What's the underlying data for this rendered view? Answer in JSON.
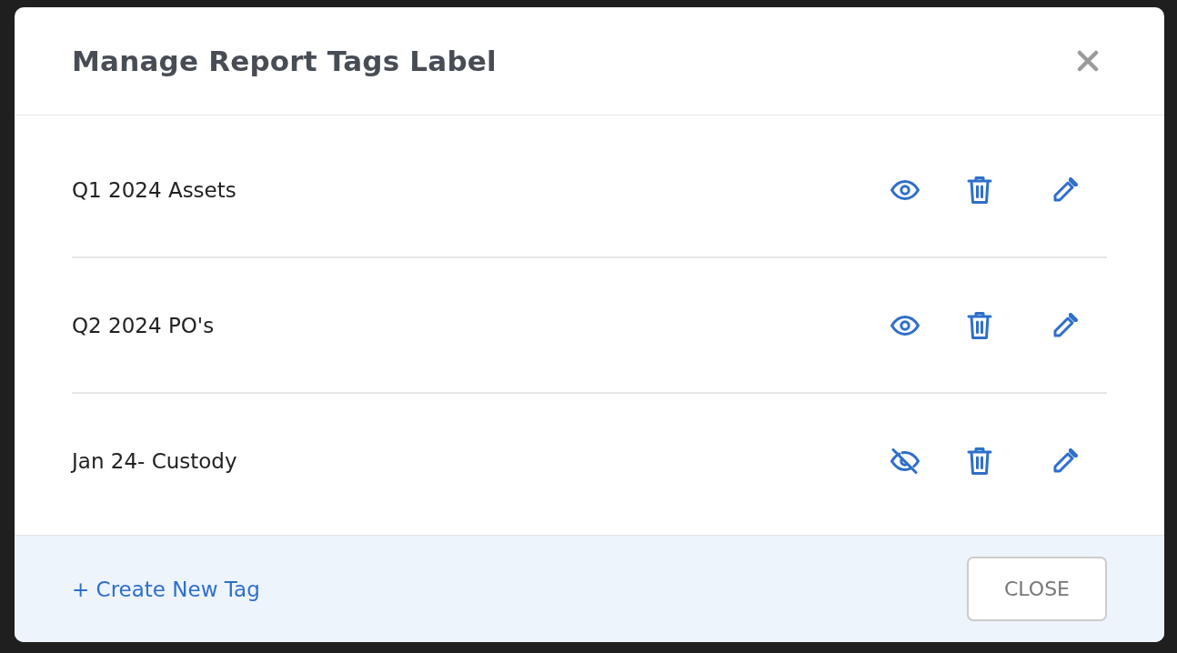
{
  "dialog": {
    "title": "Manage Report Tags Label"
  },
  "tags": [
    {
      "name": "Q1 2024 Assets",
      "visible": true
    },
    {
      "name": "Q2 2024 PO's",
      "visible": true
    },
    {
      "name": "Jan 24- Custody",
      "visible": false
    }
  ],
  "footer": {
    "create_link": "+ Create New Tag",
    "close_button": "CLOSE"
  }
}
